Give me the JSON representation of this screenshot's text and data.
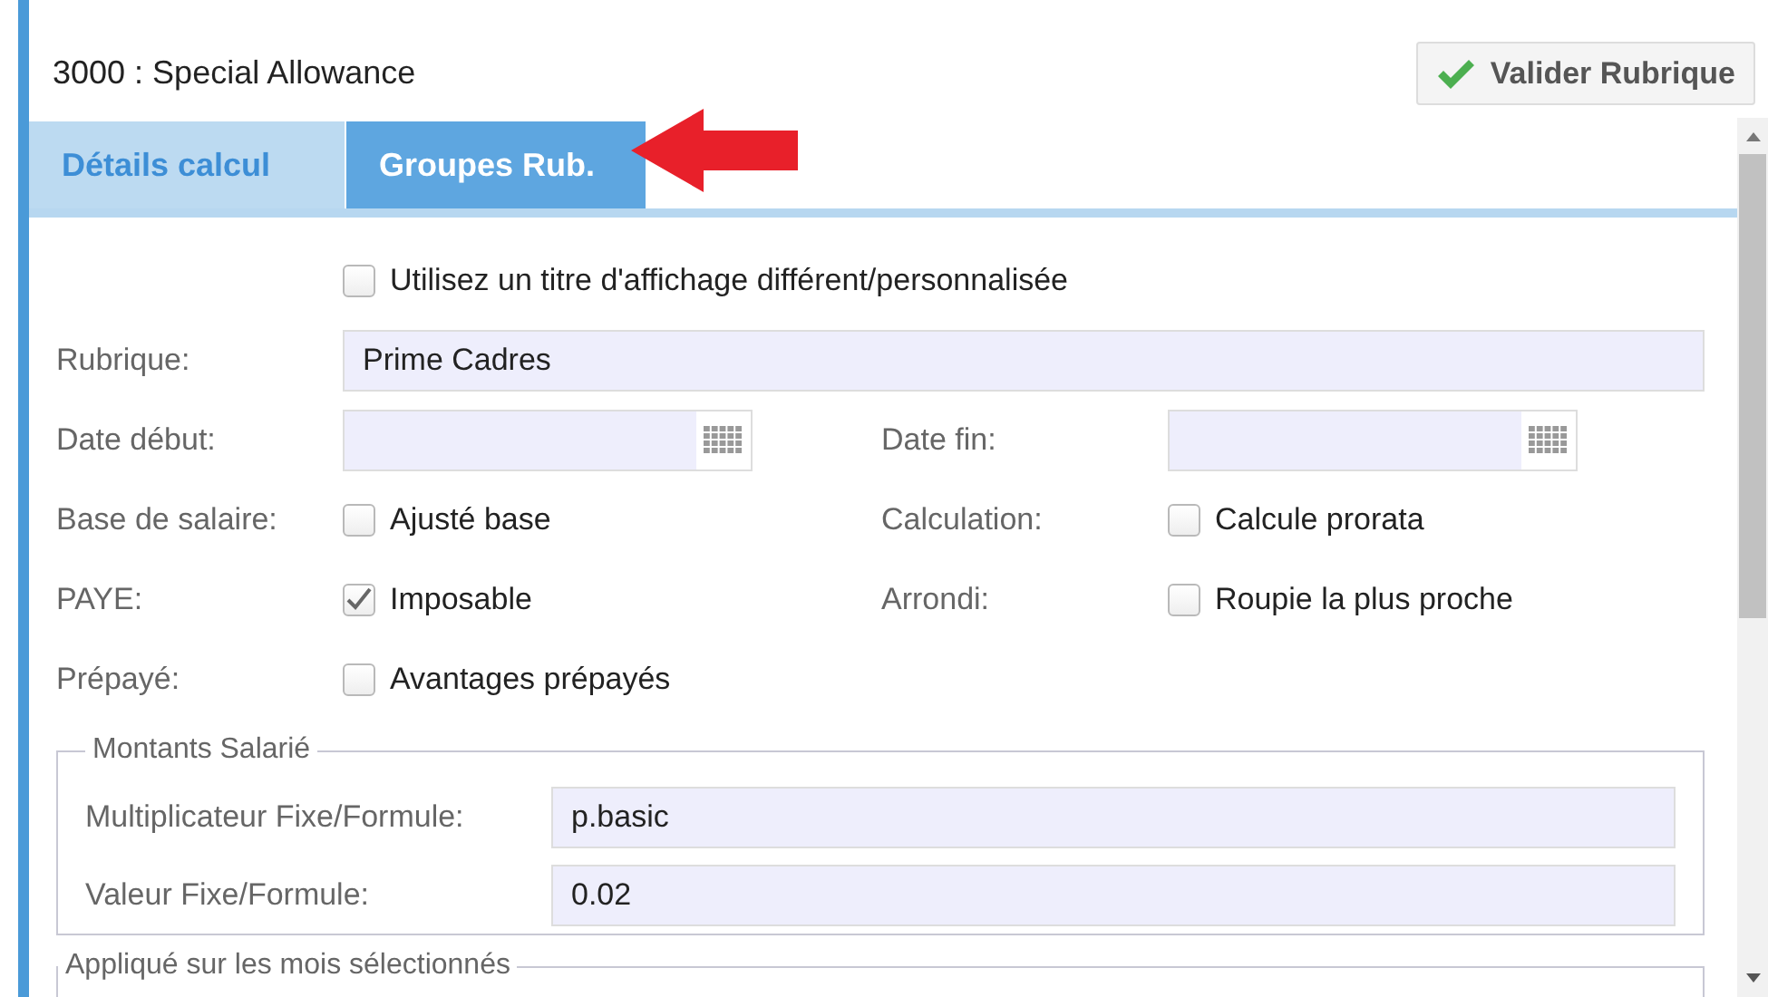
{
  "header": {
    "title": "3000 : Special Allowance",
    "validate_button": "Valider Rubrique"
  },
  "tabs": [
    {
      "label": "Détails calcul",
      "selected": false
    },
    {
      "label": "Groupes Rub.",
      "selected": true
    }
  ],
  "custom_title": {
    "label": "Utilisez un titre d'affichage différent/personnalisée",
    "checked": false
  },
  "rubrique": {
    "label": "Rubrique:",
    "value": "Prime Cadres"
  },
  "grid_rows": [
    {
      "cells": [
        {
          "kind": "date",
          "label": "Date début:"
        },
        {
          "kind": "date",
          "label": "Date fin:"
        }
      ]
    },
    {
      "cells": [
        {
          "kind": "checkbox",
          "label": "Base de salaire:",
          "option": "Ajusté base",
          "checked": false
        },
        {
          "kind": "checkbox",
          "label": "Calculation:",
          "option": "Calcule prorata",
          "checked": false
        }
      ]
    },
    {
      "cells": [
        {
          "kind": "checkbox",
          "label": "PAYE:",
          "option": "Imposable",
          "checked": true
        },
        {
          "kind": "checkbox",
          "label": "Arrondi:",
          "option": "Roupie la plus proche",
          "checked": false
        }
      ]
    },
    {
      "cells": [
        {
          "kind": "checkbox",
          "label": "Prépayé:",
          "option": "Avantages prépayés",
          "checked": false
        }
      ]
    }
  ],
  "fieldsets": [
    {
      "legend": "Montants Salarié",
      "fields": [
        {
          "label": "Multiplicateur Fixe/Formule:",
          "value": "p.basic"
        },
        {
          "label": "Valeur Fixe/Formule:",
          "value": "0.02"
        }
      ]
    },
    {
      "legend": "Appliqué sur les mois sélectionnés"
    }
  ]
}
